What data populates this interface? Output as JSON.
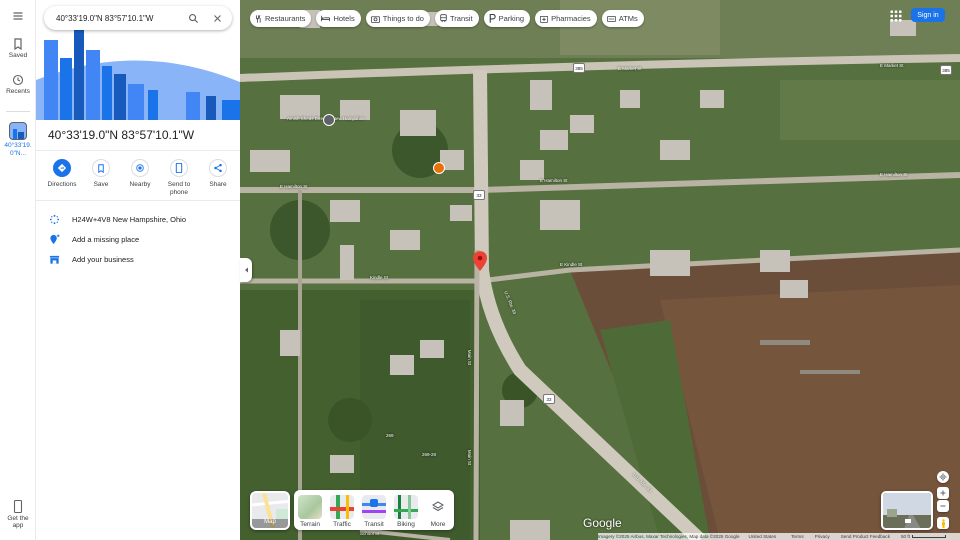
{
  "rail": {
    "menu_icon": "hamburger-icon",
    "saved_label": "Saved",
    "recents_label": "Recents",
    "recent_item_label": "40°33'19.0\"N...",
    "get_app_line1": "Get the",
    "get_app_line2": "app"
  },
  "search": {
    "query": "40°33'19.0\"N 83°57'10.1\"W",
    "search_icon": "magnifier-icon",
    "clear_icon": "close-icon"
  },
  "place": {
    "title": "40°33'19.0\"N 83°57'10.1\"W"
  },
  "actions": [
    {
      "label": "Directions",
      "icon": "directions-icon"
    },
    {
      "label": "Save",
      "icon": "bookmark-icon"
    },
    {
      "label": "Nearby",
      "icon": "nearby-icon"
    },
    {
      "label": "Send to phone",
      "icon": "phone-icon"
    },
    {
      "label": "Share",
      "icon": "share-icon"
    }
  ],
  "details": [
    {
      "text": "H24W+4V8 New Hampshire, Ohio",
      "icon": "plus-code-icon"
    },
    {
      "text": "Add a missing place",
      "icon": "add-place-icon"
    },
    {
      "text": "Add your business",
      "icon": "business-icon"
    }
  ],
  "chips": [
    {
      "label": "Restaurants",
      "icon": "fork-knife-icon"
    },
    {
      "label": "Hotels",
      "icon": "bed-icon"
    },
    {
      "label": "Things to do",
      "icon": "camera-icon"
    },
    {
      "label": "Transit",
      "icon": "train-icon"
    },
    {
      "label": "Parking",
      "icon": "parking-icon"
    },
    {
      "label": "Pharmacies",
      "icon": "pharmacy-icon"
    },
    {
      "label": "ATMs",
      "icon": "atm-icon"
    }
  ],
  "header": {
    "apps_icon": "apps-grid-icon",
    "sign_in": "Sign in"
  },
  "layers": {
    "main_label": "Map",
    "items": [
      {
        "label": "Terrain"
      },
      {
        "label": "Traffic"
      },
      {
        "label": "Transit"
      },
      {
        "label": "Biking"
      },
      {
        "label": "More"
      }
    ]
  },
  "map_labels": {
    "amish_sheds": "Amish Sheds Direct of New Hampshire",
    "market_1": "E Market St",
    "market_2": "E Market St",
    "hamilton_1": "E Hamilton St",
    "hamilton_2": "E Hamilton St",
    "hamilton_3": "E Hamilton St",
    "kindle_1": "Kindle St",
    "kindle_2": "E Kindle St",
    "main_st_1": "Main St",
    "main_st_2": "Main St",
    "us_rte_1": "U.S. Rte. 33",
    "us_rte_2": "U.S. Rte. 33",
    "school_st": "School St",
    "route_1": "385",
    "route_2": "33",
    "route_3": "33",
    "route_4": "385",
    "addr_1": "269",
    "addr_2": "269-28"
  },
  "logo": "Google",
  "footer": {
    "imagery": "Imagery ©2025 Airbus, Maxar Technologies, Map data ©2025 Google",
    "country": "United States",
    "terms": "Terms",
    "privacy": "Privacy",
    "feedback": "Send Product Feedback",
    "scale": "50 ft"
  },
  "colors": {
    "accent": "#1a73e8",
    "pin": "#ea4335"
  }
}
